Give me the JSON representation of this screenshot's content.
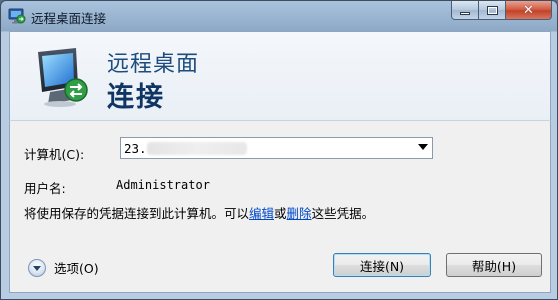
{
  "window": {
    "title": "远程桌面连接",
    "icon": "remote-desktop-icon",
    "controls": {
      "minimize": "minimize-icon",
      "maximize": "maximize-icon",
      "close": "close-icon"
    }
  },
  "banner": {
    "line1": "远程桌面",
    "line2": "连接",
    "icon": "remote-desktop-monitor-icon"
  },
  "form": {
    "computer_label": "计算机(C):",
    "computer_value": "23.",
    "username_label": "用户名:",
    "username_value": "Administrator",
    "info_before": "将使用保存的凭据连接到此计算机。可以",
    "edit_link": "编辑",
    "info_or": "或",
    "delete_link": "删除",
    "info_after": "这些凭据。"
  },
  "footer": {
    "options_label": "选项(O)",
    "connect_button": "连接(N)",
    "help_button": "帮助(H)"
  },
  "colors": {
    "banner_title": "#1d4d7e",
    "link": "#0048c8",
    "titlebar": "#a9c3de"
  }
}
